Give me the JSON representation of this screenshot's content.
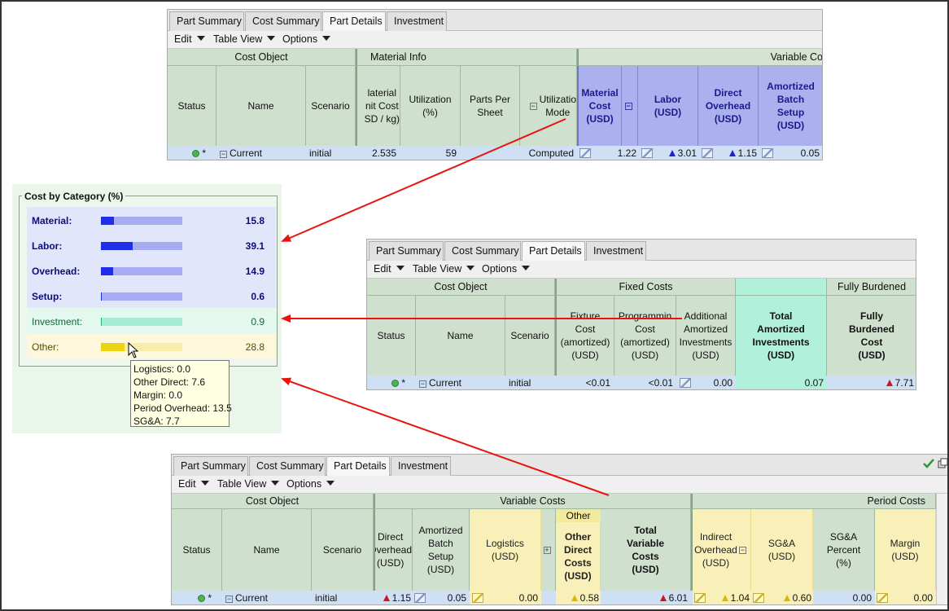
{
  "tabs": [
    "Part Summary",
    "Cost Summary",
    "Part Details",
    "Investment"
  ],
  "menus": [
    "Edit",
    "Table View",
    "Options"
  ],
  "panel1": {
    "groups": {
      "cost_object": "Cost Object",
      "material_info": "Material Info",
      "variable": "Variable Co"
    },
    "headers": {
      "status": "Status",
      "name": "Name",
      "scenario": "Scenario",
      "material_unit_cost": "laterial\nnit Cost\nSD / kg)",
      "utilization": "Utilization\n(%)",
      "parts_per_sheet": "Parts Per\nSheet",
      "utilization_mode": "Utilizatio\nMode",
      "material_cost": "Material\nCost\n(USD)",
      "labor": "Labor\n(USD)",
      "direct_overhead": "Direct\nOverhead\n(USD)",
      "amortized_batch_setup": "Amortized\nBatch\nSetup\n(USD)"
    },
    "row": {
      "marker": "*",
      "name": "Current",
      "scenario": "initial",
      "material_unit_cost": "2.535",
      "utilization": "59",
      "parts_per_sheet": "",
      "utilization_mode": "Computed",
      "material_cost": "1.22",
      "labor": "3.01",
      "direct_overhead": "1.15",
      "amortized_batch_setup": "0.05"
    }
  },
  "categories": {
    "title": "Cost by Category (%)",
    "items": [
      {
        "label": "Material:",
        "value": "15.8",
        "fraction": 0.158,
        "fill": "#1f2fe8",
        "track": "#a7abf2",
        "text": "#0d0d7a"
      },
      {
        "label": "Labor:",
        "value": "39.1",
        "fraction": 0.391,
        "fill": "#1f2fe8",
        "track": "#a7abf2",
        "text": "#0d0d7a"
      },
      {
        "label": "Overhead:",
        "value": "14.9",
        "fraction": 0.149,
        "fill": "#1f2fe8",
        "track": "#a7abf2",
        "text": "#0d0d7a"
      },
      {
        "label": "Setup:",
        "value": "0.6",
        "fraction": 0.006,
        "fill": "#1f2fe8",
        "track": "#a7abf2",
        "text": "#0d0d7a"
      },
      {
        "label": "Investment:",
        "value": "0.9",
        "fraction": 0.009,
        "fill": "#1fb880",
        "track": "#a6ecd4",
        "text": "#0d6a3a"
      },
      {
        "label": "Other:",
        "value": "28.8",
        "fraction": 0.288,
        "fill": "#ecd415",
        "track": "#f7ecaa",
        "text": "#5a4a00"
      }
    ],
    "tooltip": [
      "Logistics: 0.0",
      "Other Direct: 7.6",
      "Margin: 0.0",
      "Period Overhead: 13.5",
      "SG&A: 7.7"
    ]
  },
  "panel2": {
    "groups": {
      "cost_object": "Cost Object",
      "fixed": "Fixed Costs",
      "fully": "Fully Burdened"
    },
    "headers": {
      "status": "Status",
      "name": "Name",
      "scenario": "Scenario",
      "fixture_cost": "Fixture\nCost\n(amortized)\n(USD)",
      "programming_cost": "Programmin\nCost\n(amortized)\n(USD)",
      "additional_amortized": "Additional\nAmortized\nInvestments\n(USD)",
      "total_amortized": "Total\nAmortized\nInvestments\n(USD)",
      "fully_burdened": "Fully\nBurdened\nCost\n(USD)"
    },
    "row": {
      "marker": "*",
      "name": "Current",
      "scenario": "initial",
      "fixture_cost": "<0.01",
      "programming_cost": "<0.01",
      "additional_amortized": "0.00",
      "total_amortized": "0.07",
      "fully_burdened": "7.71"
    }
  },
  "panel3": {
    "groups": {
      "cost_object": "Cost Object",
      "variable": "Variable Costs",
      "period": "Period Costs",
      "other": "Other"
    },
    "headers": {
      "status": "Status",
      "name": "Name",
      "scenario": "Scenario",
      "direct_overhead": "Direct\nOverhead\n(USD)",
      "amortized_batch_setup": "Amortized\nBatch\nSetup\n(USD)",
      "logistics": "Logistics\n(USD)",
      "other_direct": "Other\nDirect\nCosts\n(USD)",
      "total_variable": "Total\nVariable\nCosts\n(USD)",
      "indirect_overhead": "Indirect\nOverhead\n(USD)",
      "sga": "SG&A\n(USD)",
      "sga_percent": "SG&A\nPercent\n(%)",
      "margin": "Margin\n(USD)"
    },
    "row": {
      "marker": "*",
      "name": "Current",
      "scenario": "initial",
      "direct_overhead": "1.15",
      "amortized_batch_setup": "0.05",
      "logistics": "0.00",
      "other_direct": "0.58",
      "total_variable": "6.01",
      "indirect_overhead": "1.04",
      "sga": "0.60",
      "sga_percent": "0.00",
      "margin": "0.00"
    }
  }
}
